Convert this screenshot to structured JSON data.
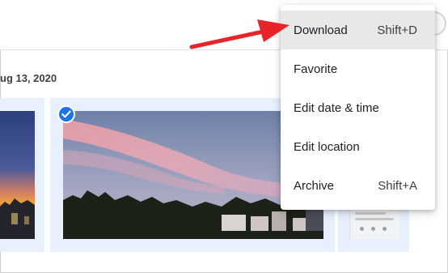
{
  "header": {
    "date_label": "ug 13, 2020"
  },
  "context_menu": {
    "items": [
      {
        "label": "Download",
        "shortcut": "Shift+D",
        "highlighted": true
      },
      {
        "label": "Favorite",
        "shortcut": ""
      },
      {
        "label": "Edit date & time",
        "shortcut": ""
      },
      {
        "label": "Edit location",
        "shortcut": ""
      },
      {
        "label": "Archive",
        "shortcut": "Shift+A"
      }
    ]
  },
  "photos": {
    "main_selected": true
  },
  "icons": {
    "selected_check": "check-circle-icon"
  },
  "colors": {
    "accent": "#1a73e8",
    "selection_bg": "#e8f0fe",
    "annotation_arrow": "#e8232a",
    "menu_highlight": "#e8e8e8"
  }
}
